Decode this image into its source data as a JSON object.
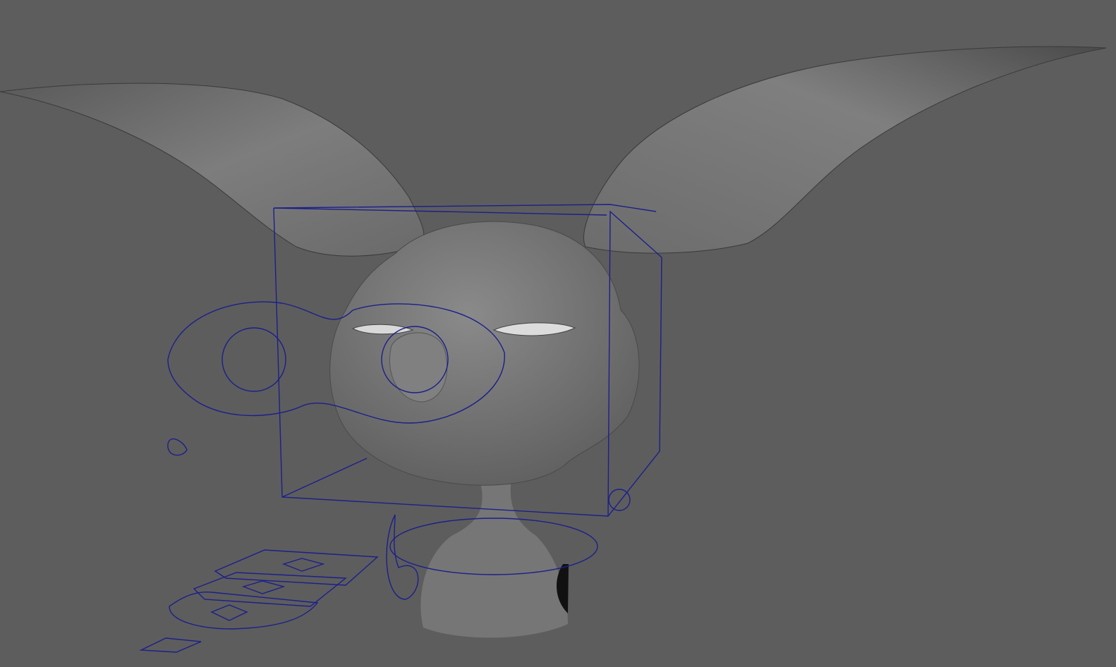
{
  "viewport": {
    "background": "#5d5d5d",
    "model_color": "#7a7a7a",
    "rig_curve_color": "#1c1f8a"
  }
}
